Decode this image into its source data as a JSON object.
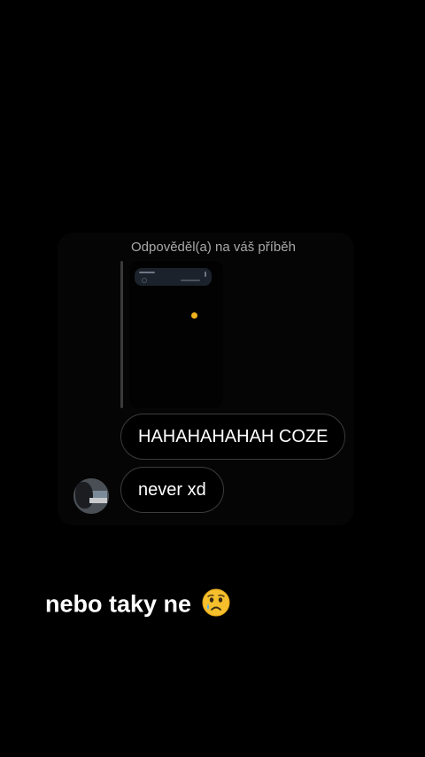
{
  "reply": {
    "header": "Odpověděl(a) na váš příběh"
  },
  "messages": [
    {
      "text": "HAHAHAHAHAH COZE"
    },
    {
      "text": "never xd"
    }
  ],
  "caption": {
    "text": "nebo taky ne",
    "emoji": "sad-tear-face-icon"
  },
  "colors": {
    "background": "#000000",
    "bubble_border": "#3c3c3c",
    "header_text": "#a8a8a8",
    "emoji_yellow": "#f2b21f"
  }
}
